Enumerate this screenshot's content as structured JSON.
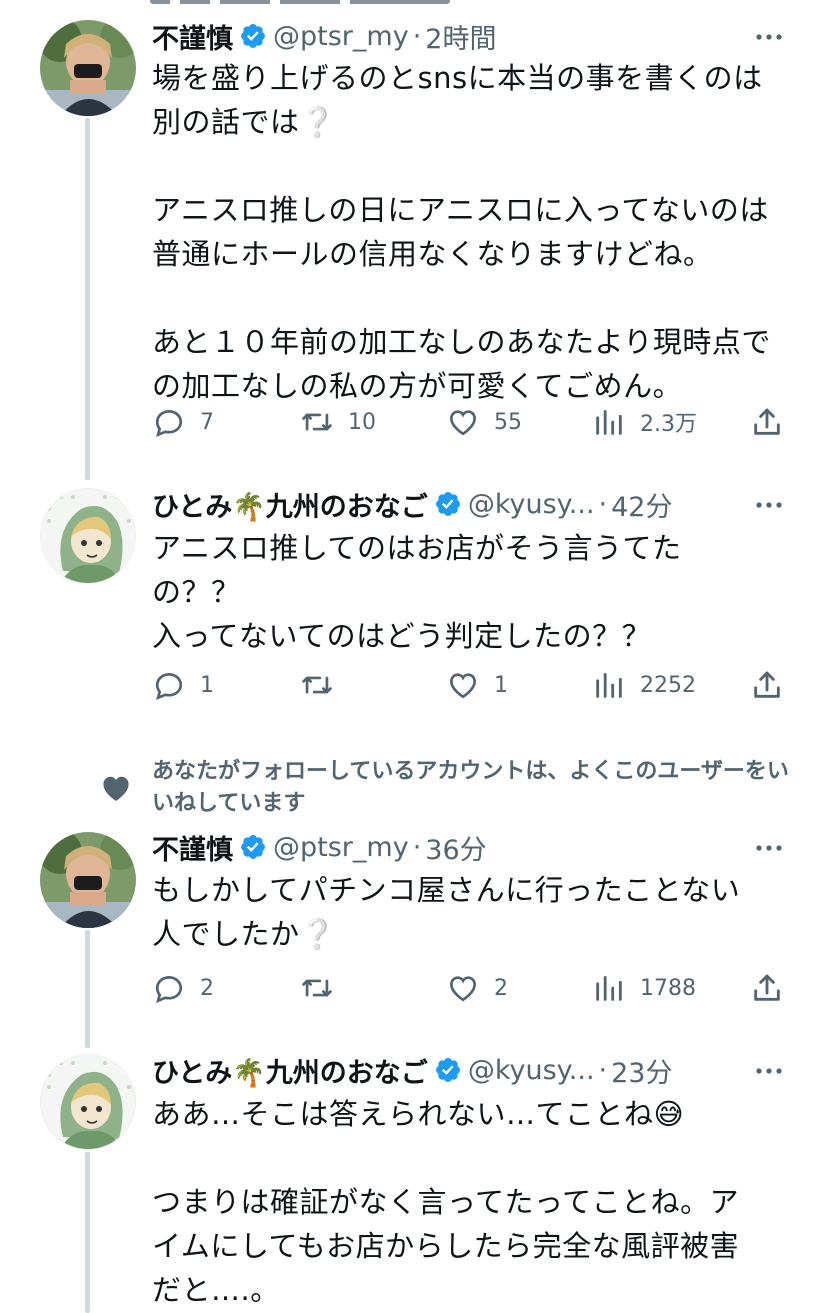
{
  "tweets": [
    {
      "name": "不謹慎",
      "handle": "@ptsr_my",
      "dot": "·",
      "time": "2時間",
      "body": "場を盛り上げるのとsnsに本当の事を書くのは\n別の話では❔\n\nアニスロ推しの日にアニスロに入ってないのは\n普通にホールの信用なくなりますけどね。\n\nあと１０年前の加工なしのあなたより現時点で\nの加工なしの私の方が可愛くてごめん。",
      "replies": "7",
      "retweets": "10",
      "likes": "55",
      "views": "2.3万"
    },
    {
      "name": "ひとみ🌴九州のおなご",
      "handle": "@kyusy...",
      "dot": "·",
      "time": "42分",
      "body": "アニスロ推してのはお店がそう言うてた\nの？？\n入ってないてのはどう判定したの？？",
      "replies": "1",
      "retweets": "",
      "likes": "1",
      "views": "2252"
    },
    {
      "name": "不謹慎",
      "handle": "@ptsr_my",
      "dot": "·",
      "time": "36分",
      "body": "もしかしてパチンコ屋さんに行ったことない\n人でしたか❔",
      "replies": "2",
      "retweets": "",
      "likes": "2",
      "views": "1788"
    },
    {
      "name": "ひとみ🌴九州のおなご",
      "handle": "@kyusy...",
      "dot": "·",
      "time": "23分",
      "body": "ああ…そこは答えられない…てことね😅\n\nつまりは確証がなく言ってたってことね。ア\nイムにしてもお店からしたら完全な風評被害\nだと….。"
    }
  ],
  "social_context": "あなたがフォローしているアカウントは、よくこのユーザーをいいねしています",
  "colors": {
    "text": "#0f1419",
    "secondary": "#536471",
    "verified": "#1d9bf0",
    "thread_line": "#cfd9de"
  }
}
